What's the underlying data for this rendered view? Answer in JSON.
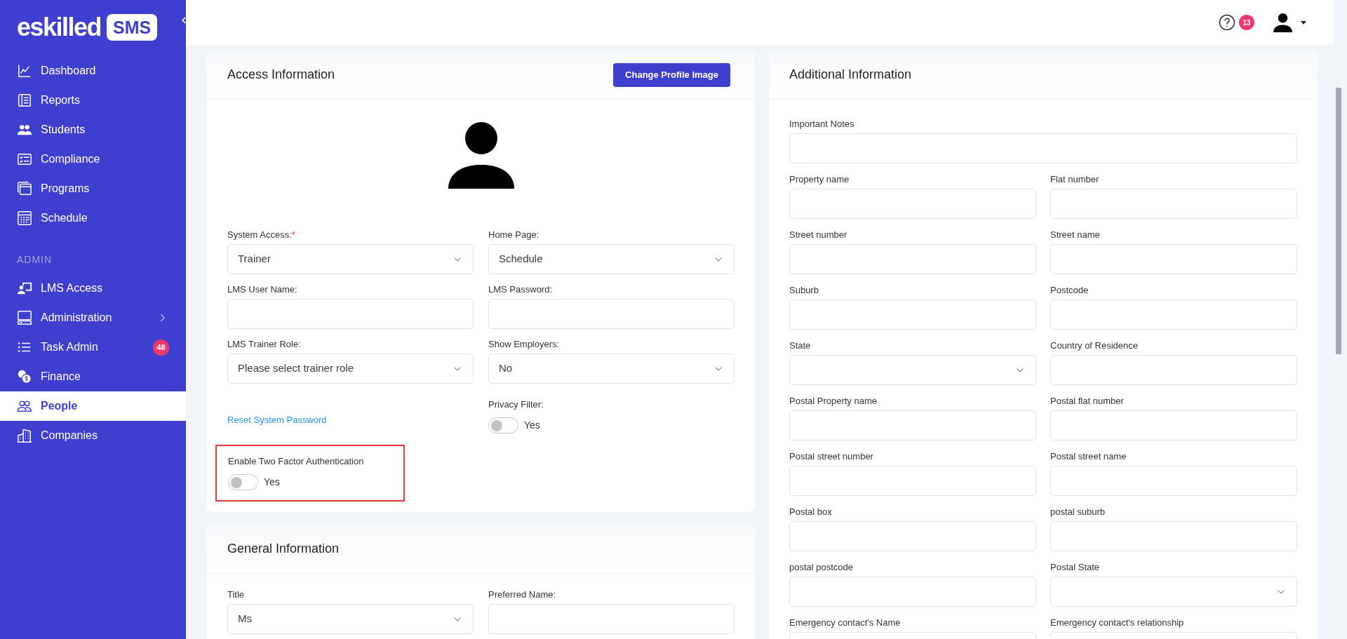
{
  "sidebar": {
    "logo": {
      "word": "eskilled",
      "badge": "SMS"
    },
    "items": [
      {
        "label": "Dashboard",
        "selected": false
      },
      {
        "label": "Reports",
        "selected": false
      },
      {
        "label": "Students",
        "selected": false
      },
      {
        "label": "Compliance",
        "selected": false
      },
      {
        "label": "Programs",
        "selected": false
      },
      {
        "label": "Schedule",
        "selected": false
      }
    ],
    "section_title": "ADMIN",
    "admin_items": [
      {
        "label": "LMS Access",
        "selected": false
      },
      {
        "label": "Administration",
        "selected": false,
        "has_submenu": true
      },
      {
        "label": "Task Admin",
        "selected": false,
        "badge": "48"
      },
      {
        "label": "Finance",
        "selected": false
      },
      {
        "label": "People",
        "selected": true
      },
      {
        "label": "Companies",
        "selected": false
      }
    ]
  },
  "header": {
    "notification_count": "13"
  },
  "access_card": {
    "title": "Access Information",
    "button": "Change Profile Image",
    "fields": [
      {
        "label": "System Access:",
        "required_mark": "*",
        "kind": "select",
        "value": "Trainer"
      },
      {
        "label": "Home Page:",
        "kind": "select",
        "value": "Schedule"
      },
      {
        "label": "LMS User Name:",
        "kind": "text"
      },
      {
        "label": "LMS Password:",
        "kind": "text"
      },
      {
        "label": "LMS Trainer Role:",
        "kind": "select",
        "value": "Please select trainer role"
      },
      {
        "label": "Show Employers:",
        "kind": "select",
        "value": "No"
      }
    ],
    "reset_link": "Reset System Password",
    "privacy_filter": {
      "label": "Privacy Filter:",
      "on": false,
      "text": "Yes"
    },
    "two_factor": {
      "label": "Enable Two Factor Authentication",
      "on": false,
      "text": "Yes",
      "highlighted": true
    }
  },
  "general_card": {
    "title": "General Information",
    "fields": [
      {
        "label": "Title",
        "kind": "select",
        "value": "Ms"
      },
      {
        "label": "Preferred Name:",
        "kind": "text"
      }
    ]
  },
  "additional_card": {
    "title": "Additional Information",
    "fields": [
      {
        "label": "Important Notes",
        "kind": "text",
        "wide": true
      },
      {
        "label": "Property name",
        "kind": "text"
      },
      {
        "label": "Flat number",
        "kind": "text"
      },
      {
        "label": "Street number",
        "kind": "text"
      },
      {
        "label": "Street name",
        "kind": "text"
      },
      {
        "label": "Suburb",
        "kind": "text"
      },
      {
        "label": "Postcode",
        "kind": "text"
      },
      {
        "label": "State",
        "kind": "select"
      },
      {
        "label": "Country of Residence",
        "kind": "text"
      },
      {
        "label": "Postal Property name",
        "kind": "text"
      },
      {
        "label": "Postal flat number",
        "kind": "text"
      },
      {
        "label": "Postal street number",
        "kind": "text"
      },
      {
        "label": "Postal street name",
        "kind": "text"
      },
      {
        "label": "Postal box",
        "kind": "text"
      },
      {
        "label": "postal suburb",
        "kind": "text"
      },
      {
        "label": "postal postcode",
        "kind": "text"
      },
      {
        "label": "Postal State",
        "kind": "select"
      },
      {
        "label": "Emergency contact's Name",
        "kind": "text"
      },
      {
        "label": "Emergency contact's relationship",
        "kind": "text"
      }
    ]
  }
}
